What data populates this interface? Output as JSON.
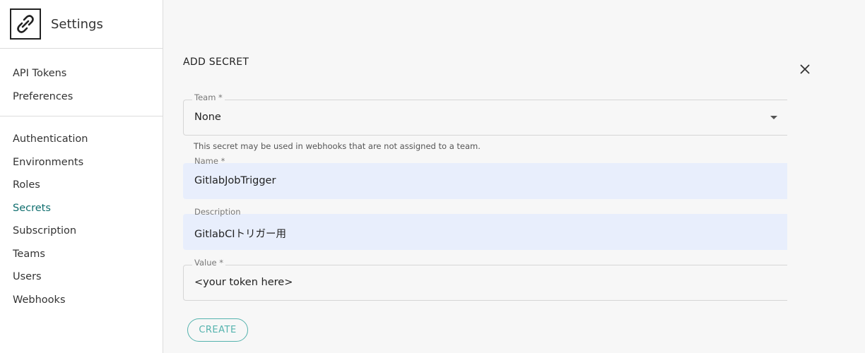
{
  "app": {
    "title": "Settings"
  },
  "sidebar": {
    "group1": [
      {
        "label": "API Tokens"
      },
      {
        "label": "Preferences"
      }
    ],
    "group2": [
      {
        "label": "Authentication"
      },
      {
        "label": "Environments"
      },
      {
        "label": "Roles"
      },
      {
        "label": "Secrets",
        "active": true
      },
      {
        "label": "Subscription"
      },
      {
        "label": "Teams"
      },
      {
        "label": "Users"
      },
      {
        "label": "Webhooks"
      }
    ]
  },
  "form": {
    "title": "ADD SECRET",
    "team": {
      "label": "Team *",
      "value": "None"
    },
    "helper": "This secret may be used in webhooks that are not assigned to a team.",
    "name": {
      "label": "Name *",
      "value": "GitlabJobTrigger"
    },
    "description": {
      "label": "Description",
      "value": "GitlabCIトリガー用"
    },
    "value": {
      "label": "Value *",
      "value": "<your token here>"
    },
    "create_label": "CREATE"
  },
  "colors": {
    "accent": "#0f6e6e",
    "button": "#55b3ae",
    "filled_field": "#e8eefc"
  },
  "icons": {
    "logo": "link-logo-icon",
    "close": "close-icon",
    "dropdown": "chevron-down-icon"
  }
}
